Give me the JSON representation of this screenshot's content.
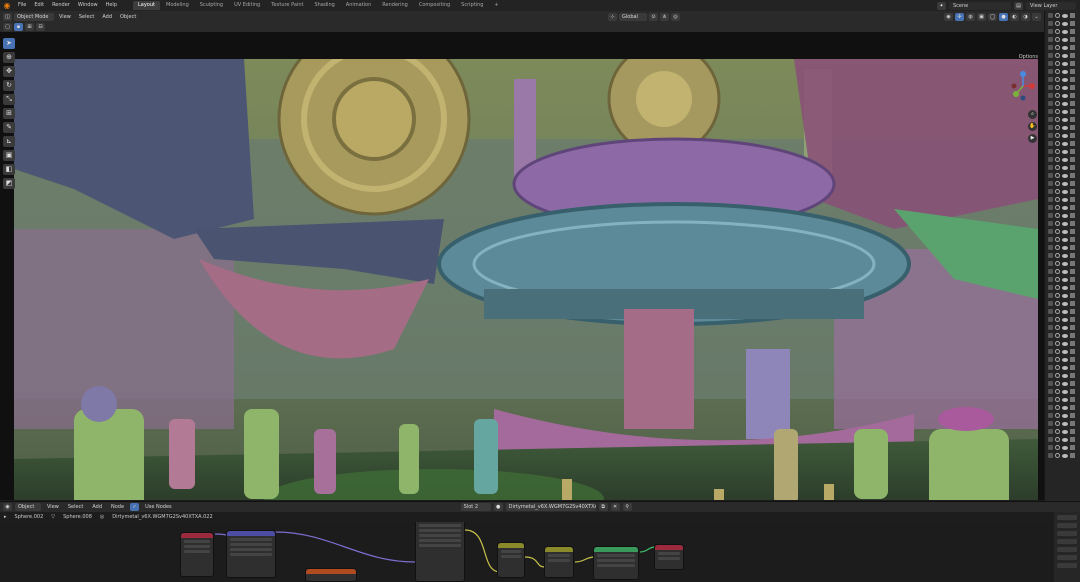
{
  "menubar": {
    "items": [
      "File",
      "Edit",
      "Render",
      "Window",
      "Help"
    ],
    "workspaces": [
      "Layout",
      "Modeling",
      "Sculpting",
      "UV Editing",
      "Texture Paint",
      "Shading",
      "Animation",
      "Rendering",
      "Compositing",
      "Scripting"
    ],
    "active_workspace": "Layout",
    "add_tab": "+",
    "scene_label": "Scene",
    "view_layer_label": "View Layer"
  },
  "viewport_header": {
    "mode": "Object Mode",
    "menus": [
      "View",
      "Select",
      "Add",
      "Object"
    ],
    "orientation": "Global",
    "options": "Options"
  },
  "node_editor": {
    "editor_type": "Object",
    "menus": [
      "View",
      "Select",
      "Add",
      "Node"
    ],
    "use_nodes_label": "Use Nodes",
    "use_nodes_checked": true,
    "slot": "Slot 2",
    "material_name": "Dirtymetal_v6X.WGM7G2Sv40XTXA.022",
    "breadcrumbs": [
      "Sphere.002",
      "Sphere.008",
      "Dirtymetal_v6X.WGM7G2Sv40XTXA.022"
    ]
  },
  "colors": {
    "accent": "#4772b3",
    "blender_orange": "#e87d0d",
    "shader_node": "#3a9a5c",
    "texture_node": "#b04a1f",
    "output_node": "#9c2a3c"
  }
}
